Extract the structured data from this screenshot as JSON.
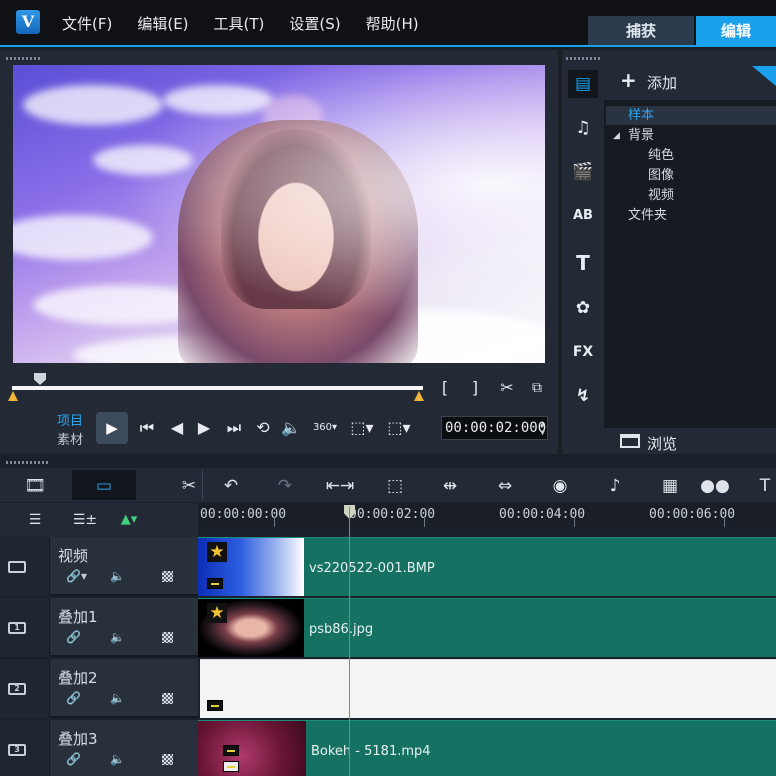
{
  "app": {
    "logo": "V",
    "menu": [
      "文件(F)",
      "编辑(E)",
      "工具(T)",
      "设置(S)",
      "帮助(H)"
    ],
    "tabs": {
      "capture": "捕获",
      "edit": "编辑"
    }
  },
  "player": {
    "mode_project": "项目",
    "mode_clip": "素材",
    "timecode": "00:00:02:000",
    "progress_fraction": 0.07
  },
  "library": {
    "add_label": "添加",
    "browse_label": "浏览",
    "tree": {
      "sample": "样本",
      "background": "背景",
      "solid": "纯色",
      "image": "图像",
      "video": "视频",
      "folder": "文件夹"
    },
    "icons": [
      "media-icon",
      "audio-icon",
      "transition-icon",
      "title-ab-icon",
      "text-icon",
      "graphics-icon",
      "fx-icon",
      "path-icon"
    ]
  },
  "timeline": {
    "ruler": [
      "00:00:00:00",
      "00:00:02:00",
      "00:00:04:00",
      "00:00:06:00"
    ],
    "tracks": [
      {
        "num": "",
        "name": "视频",
        "clip": "vs220522-001.BMP"
      },
      {
        "num": "1",
        "name": "叠加1",
        "clip": "psb86.jpg"
      },
      {
        "num": "2",
        "name": "叠加2",
        "clip": ""
      },
      {
        "num": "3",
        "name": "叠加3",
        "clip": "Bokeh - 5181.mp4"
      }
    ]
  },
  "colors": {
    "accent": "#1aa1ec",
    "clip_green": "#157162",
    "panel": "#232a36"
  }
}
